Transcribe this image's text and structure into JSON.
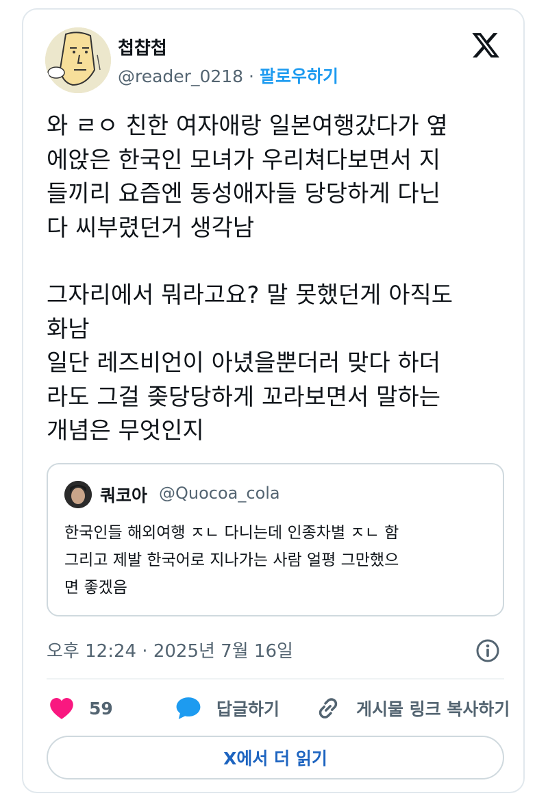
{
  "author": {
    "display_name": "첩챱첩",
    "handle": "@reader_0218",
    "separator": "·",
    "follow_label": "팔로우하기"
  },
  "tweet": {
    "lines_part1": [
      "와 ㄹㅇ 친한 여자애랑 일본여행갔다가 옆",
      "에앉은 한국인 모녀가 우리쳐다보면서 지",
      "들끼리 요즘엔 동성애자들 당당하게 다닌",
      "다 씨부렸던거 생각남"
    ],
    "lines_part2": [
      "그자리에서 뭐라고요? 말 못했던게 아직도",
      "화남",
      "일단 레즈비언이 아녔을뿐더러 맞다 하더",
      "라도 그걸 좆당당하게 꼬라보면서 말하는",
      "개념은 무엇인지"
    ]
  },
  "quote": {
    "display_name": "쿼코아",
    "handle": "@Quocoa_cola",
    "lines": [
      "한국인들 해외여행 ㅈㄴ 다니는데 인종차별 ㅈㄴ 함",
      "그리고 제발 한국어로 지나가는 사람 얼평 그만했으",
      "면 좋겠음"
    ]
  },
  "timestamp": "오후 12:24 · 2025년 7월 16일",
  "actions": {
    "like_count": "59",
    "reply_label": "답글하기",
    "copy_link_label": "게시물 링크 복사하기"
  },
  "read_more_label": "X에서 더 읽기",
  "colors": {
    "like": "#f91880",
    "reply": "#1d9bf0",
    "link": "#1d9bf0",
    "muted": "#536471"
  },
  "icons": {
    "brand": "x-logo-icon",
    "info": "info-icon",
    "like": "heart-icon",
    "reply": "speech-bubble-icon",
    "copy": "link-icon"
  }
}
